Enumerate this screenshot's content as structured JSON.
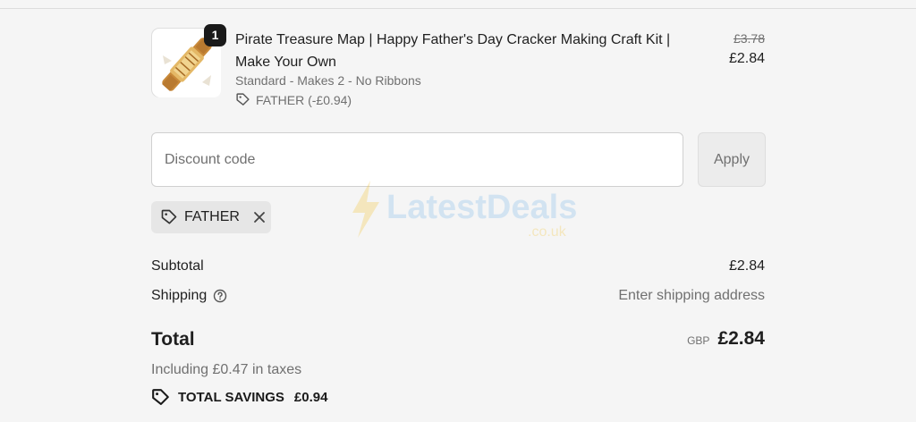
{
  "product": {
    "title": "Pirate Treasure Map | Happy Father's Day Cracker Making Craft Kit | Make Your Own",
    "variant": "Standard - Makes 2 - No Ribbons",
    "discount_applied": "FATHER (-£0.94)",
    "quantity": "1",
    "price_original": "£3.78",
    "price_current": "£2.84",
    "thumbnail_icon": "cracker-product-image"
  },
  "discount": {
    "placeholder": "Discount code",
    "value": "",
    "apply_label": "Apply",
    "applied_code": "FATHER"
  },
  "summary": {
    "subtotal_label": "Subtotal",
    "subtotal_value": "£2.84",
    "shipping_label": "Shipping",
    "shipping_value": "Enter shipping address",
    "total_label": "Total",
    "total_currency": "GBP",
    "total_value": "£2.84",
    "taxes_note": "Including £0.47 in taxes",
    "savings_label": "TOTAL SAVINGS",
    "savings_value": "£0.94"
  },
  "watermark": {
    "brand": "LatestDeals",
    "domain": ".co.uk"
  },
  "colors": {
    "background": "#f5f5f5",
    "text": "#1f1f1f",
    "muted": "#707070",
    "badge": "#1a1a1a",
    "watermark_blue": "#7ab8e8",
    "watermark_yellow": "#f2c230"
  }
}
